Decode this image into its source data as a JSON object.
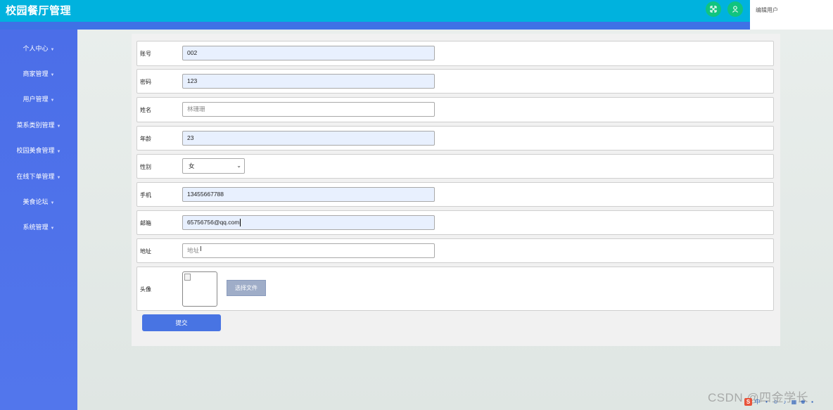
{
  "header": {
    "app_title": "校园餐厅管理",
    "icons": [
      "fullscreen-icon",
      "user-icon"
    ],
    "breadcrumb": "编辑用户",
    "colors": {
      "header": "#00b2de",
      "strip": "#3f71e6",
      "icon_bg": "#11c47f"
    }
  },
  "sidebar": {
    "items": [
      {
        "label": "个人中心"
      },
      {
        "label": "商家管理"
      },
      {
        "label": "用户管理"
      },
      {
        "label": "菜系类别管理"
      },
      {
        "label": "校园美食管理"
      },
      {
        "label": "在线下单管理"
      },
      {
        "label": "美食论坛"
      },
      {
        "label": "系统管理"
      }
    ],
    "color": "#4b6ee8"
  },
  "form": {
    "fields": {
      "account": {
        "label": "账号",
        "value": "002"
      },
      "password": {
        "label": "密码",
        "value": "123"
      },
      "name": {
        "label": "姓名",
        "placeholder": "林珊珊"
      },
      "age": {
        "label": "年龄",
        "value": "23"
      },
      "gender": {
        "label": "性别",
        "value": "女"
      },
      "phone": {
        "label": "手机",
        "value": "13455667788"
      },
      "email": {
        "label": "邮箱",
        "value": "65756756@qq.com"
      },
      "address": {
        "label": "地址",
        "placeholder": "地址"
      },
      "avatar": {
        "label": "头像",
        "file_button": "选择文件"
      }
    },
    "submit_label": "提交",
    "submit_color": "#4874e3"
  },
  "watermark": "CSDN @四金学长"
}
